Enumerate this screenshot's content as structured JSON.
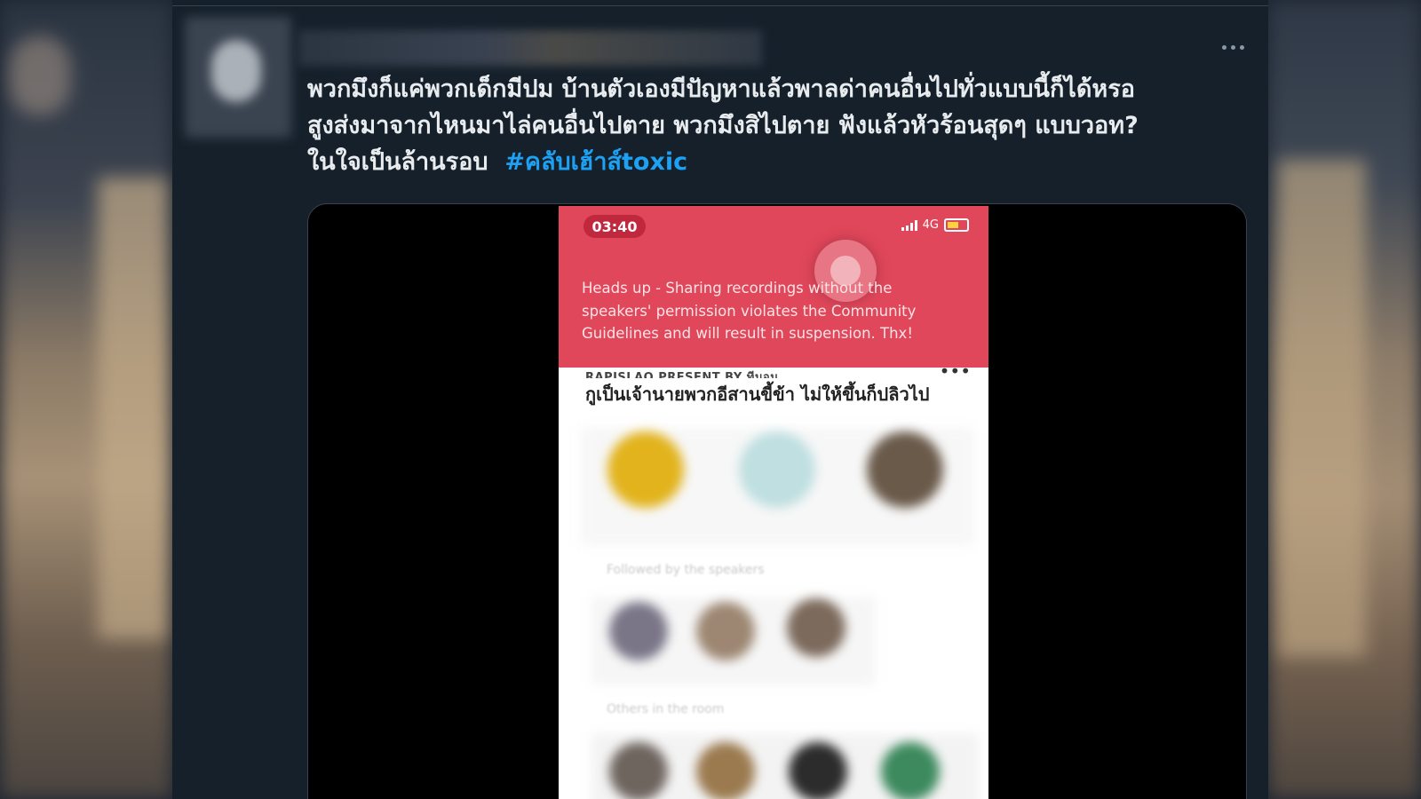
{
  "tweet": {
    "text_lines": [
      "พวกมึงก็แค่พวกเด็กมีปม บ้านตัวเองมีปัญหาแล้วพาลด่าคนอื่นไปทั่วแบบนี้ก็ได้หรอ",
      "สูงส่งมาจากไหนมาไล่คนอื่นไปตาย  พวกมึงสิไปตาย ฟังแล้วหัวร้อนสุดๆ แบบวอท?",
      "ในใจเป็นล้านรอบ"
    ],
    "hashtag": "#คลับเฮ้าส์toxic",
    "more_icon": "more-horizontal-icon"
  },
  "phone_screen": {
    "time": "03:40",
    "network": "4G",
    "alert_lines": [
      "Heads up - Sharing recordings without the",
      "speakers' permission violates the Community",
      "Guidelines and will result in suspension. Thx!"
    ],
    "room_header": "RAPISLAO PRESENT BY ทีมอน",
    "room_title": "กูเป็นเจ้านายพวกอีสานขี้ข้า ไม่ให้ขึ้นก็ปลิวไป",
    "followed_label": "Followed by the speakers",
    "others_label": "Others in the room",
    "alert_color": "#e0475a"
  }
}
